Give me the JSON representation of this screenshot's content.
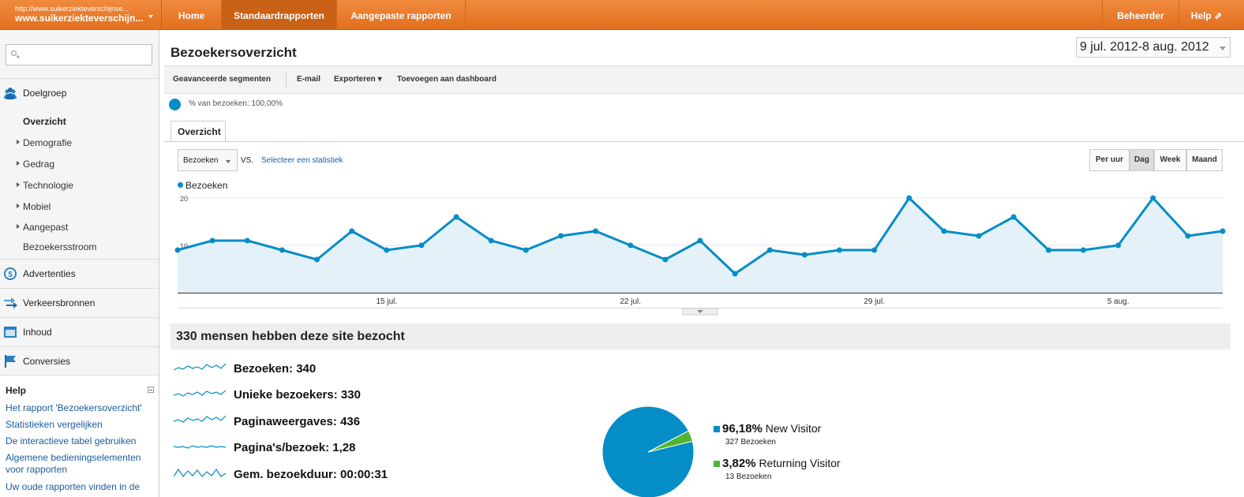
{
  "topbar": {
    "site_url": "http://www.suikerziekteverschijnse...",
    "site_name": "www.suikerziekteverschijn...",
    "tabs": [
      "Home",
      "Standaardrapporten",
      "Aangepaste rapporten"
    ],
    "admin": "Beheerder",
    "help": "Help ⇗"
  },
  "sidebar": {
    "search_placeholder": "",
    "audience": "Doelgroep",
    "audience_items": [
      {
        "label": "Overzicht"
      },
      {
        "label": "Demografie"
      },
      {
        "label": "Gedrag"
      },
      {
        "label": "Technologie"
      },
      {
        "label": "Mobiel"
      },
      {
        "label": "Aangepast"
      },
      {
        "label": "Bezoekersstroom"
      }
    ],
    "sections": [
      "Advertenties",
      "Verkeersbronnen",
      "Inhoud",
      "Conversies"
    ],
    "help_title": "Help",
    "help_links": [
      "Het rapport 'Bezoekersoverzicht'",
      "Statistieken vergelijken",
      "De interactieve tabel gebruiken",
      "Algemene bedieningselementen voor rapporten",
      "Uw oude rapporten vinden in de"
    ]
  },
  "main": {
    "title": "Bezoekersoverzicht",
    "date_start": "9 jul. 2012",
    "date_sep": "-",
    "date_end": "8 aug. 2012",
    "toolbar": [
      "Geavanceerde segmenten",
      "E-mail",
      "Exporteren ▾",
      "Toevoegen aan dashboard"
    ],
    "segment_info": "% van bezoeken: 100,00%",
    "tab": "Overzicht",
    "metric_select": "Bezoeken",
    "vs": "VS.",
    "select_stat": "Selecteer een statistiek",
    "granularity": [
      "Per uur",
      "Dag",
      "Week",
      "Maand"
    ],
    "granularity_selected": "Dag",
    "summary": "330 mensen hebben deze site bezocht",
    "metrics": [
      {
        "label": "Bezoeken:",
        "value": "340"
      },
      {
        "label": "Unieke bezoekers:",
        "value": "330"
      },
      {
        "label": "Paginaweergaves:",
        "value": "436"
      },
      {
        "label": "Pagina's/bezoek:",
        "value": "1,28"
      },
      {
        "label": "Gem. bezoekduur:",
        "value": "00:00:31"
      }
    ]
  },
  "chart_data": [
    {
      "type": "area",
      "series": [
        {
          "name": "Bezoeken",
          "values": [
            9,
            11,
            11,
            9,
            7,
            13,
            9,
            10,
            16,
            11,
            9,
            12,
            13,
            10,
            7,
            11,
            4,
            9,
            8,
            9,
            9,
            20,
            13,
            12,
            16,
            9,
            9,
            10,
            20,
            12,
            13
          ]
        }
      ],
      "x_start": "2012-07-09",
      "x_end": "2012-08-08",
      "xticks": [
        "15 jul.",
        "22 jul.",
        "29 jul.",
        "5 aug."
      ],
      "yticks": [
        10,
        20
      ],
      "ylim": [
        0,
        20
      ],
      "color": "#058dc7"
    },
    {
      "type": "pie",
      "slices": [
        {
          "name": "New Visitor",
          "percent": "96,18%",
          "value": 327,
          "sub": "327 Bezoeken",
          "color": "#058dc7"
        },
        {
          "name": "Returning Visitor",
          "percent": "3,82%",
          "value": 13,
          "sub": "13 Bezoeken",
          "color": "#50b432"
        }
      ]
    }
  ]
}
